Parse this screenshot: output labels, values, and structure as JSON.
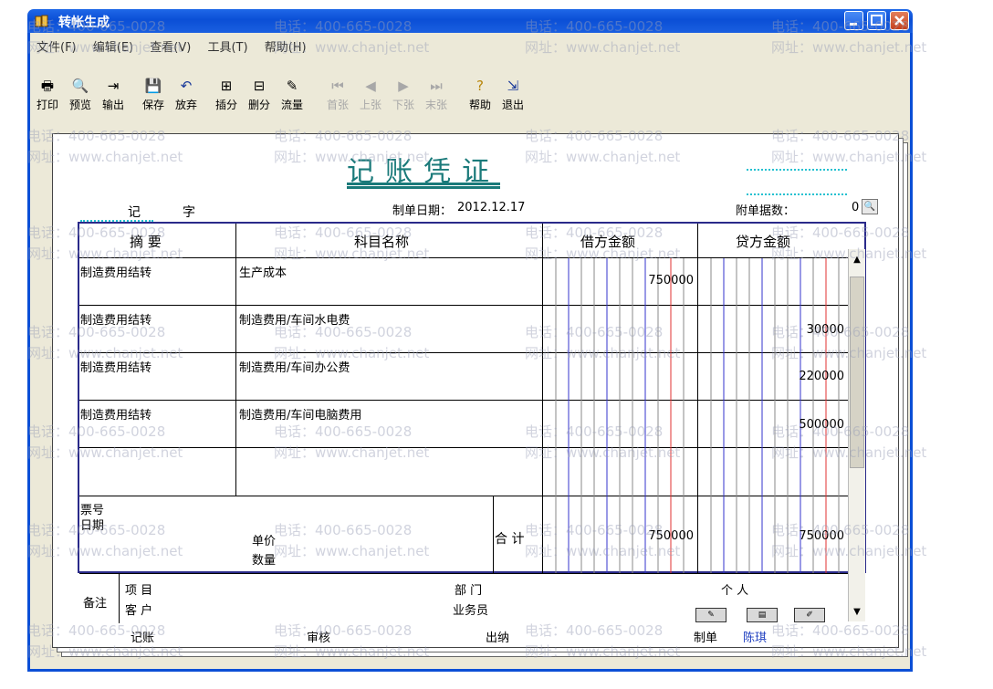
{
  "window": {
    "title": "转帐生成",
    "titlebar_color": "#0b4fd6",
    "min_icon": "minimize-icon",
    "max_icon": "maximize-icon",
    "close_icon": "close-icon"
  },
  "menu": [
    "文件(F)",
    "编辑(E)",
    "查看(V)",
    "工具(T)",
    "帮助(H)"
  ],
  "toolbar": [
    {
      "label": "打印",
      "icon": "printer-icon",
      "enabled": true
    },
    {
      "label": "预览",
      "icon": "preview-icon",
      "enabled": true
    },
    {
      "label": "输出",
      "icon": "export-icon",
      "enabled": true
    },
    {
      "label": "保存",
      "icon": "save-icon",
      "enabled": true
    },
    {
      "label": "放弃",
      "icon": "undo-icon",
      "enabled": true
    },
    {
      "label": "插分",
      "icon": "insert-row-icon",
      "enabled": true
    },
    {
      "label": "删分",
      "icon": "delete-row-icon",
      "enabled": true
    },
    {
      "label": "流量",
      "icon": "flow-icon",
      "enabled": true
    },
    {
      "label": "首张",
      "icon": "first-icon",
      "enabled": false
    },
    {
      "label": "上张",
      "icon": "prev-icon",
      "enabled": false
    },
    {
      "label": "下张",
      "icon": "next-icon",
      "enabled": false
    },
    {
      "label": "末张",
      "icon": "last-icon",
      "enabled": false
    },
    {
      "label": "帮助",
      "icon": "help-icon",
      "enabled": true
    },
    {
      "label": "退出",
      "icon": "exit-icon",
      "enabled": true
    }
  ],
  "watermark": {
    "phone": "电话：400-665-0028",
    "site": "网址：www.chanjet.net"
  },
  "voucher": {
    "title": "记账凭证",
    "type_label": "记",
    "number_label": "字",
    "date_label": "制单日期：",
    "date_value": "2012.12.17",
    "attachments_label": "附单据数：",
    "attachments_value": "0",
    "headers": {
      "summary": "摘 要",
      "account": "科目名称",
      "debit": "借方金额",
      "credit": "贷方金额"
    },
    "rows": [
      {
        "summary": "制造费用结转",
        "account": "生产成本",
        "debit": "750000",
        "credit": ""
      },
      {
        "summary": "制造费用结转",
        "account": "制造费用/车间水电费",
        "debit": "",
        "credit": "30000"
      },
      {
        "summary": "制造费用结转",
        "account": "制造费用/车间办公费",
        "debit": "",
        "credit": "220000"
      },
      {
        "summary": "制造费用结转",
        "account": "制造费用/车间电脑费用",
        "debit": "",
        "credit": "500000"
      },
      {
        "summary": "",
        "account": "",
        "debit": "",
        "credit": ""
      }
    ],
    "footer": {
      "ticket_label": "票号",
      "date_label": "日期",
      "price_label": "单价",
      "qty_label": "数量",
      "total_label": "合 计",
      "total_debit": "750000",
      "total_credit": "750000"
    },
    "remarks": {
      "label": "备注",
      "project_label": "项 目",
      "customer_label": "客 户",
      "dept_label": "部 门",
      "salesperson_label": "业务员",
      "personal_label": "个 人"
    },
    "signatures": {
      "bookkeeper": "记账",
      "reviewer": "审核",
      "cashier": "出纳",
      "maker": "制单",
      "maker_name": "陈琪"
    }
  }
}
